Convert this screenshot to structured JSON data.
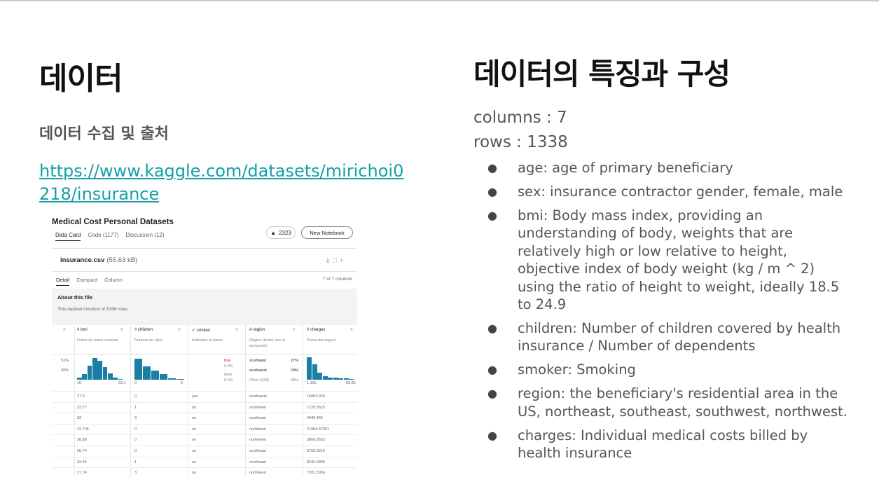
{
  "left": {
    "title": "데이터",
    "subtitle": "데이터 수집 및 출처",
    "source_url": "https://www.kaggle.com/datasets/mirichoi0218/insurance"
  },
  "kaggle": {
    "dataset_title": "Medical Cost Personal Datasets",
    "tabs": [
      "Data Card",
      "Code (1177)",
      "Discussion (12)"
    ],
    "vote_count": "2323",
    "new_notebook": "New Notebook",
    "file_name": "insurance.csv",
    "file_size": "(55.63 kB)",
    "view_tabs": [
      "Detail",
      "Compact",
      "Column"
    ],
    "column_count": "7 of 7 columns",
    "about_title": "About this file",
    "about_text": "This dataset consists of 1338 rows.",
    "columns": [
      {
        "name": "# bmi",
        "desc": "Índice de masa corporal"
      },
      {
        "name": "# children",
        "desc": "Número de hijos"
      },
      {
        "name": "✓ smoker",
        "desc": "Indicador al fumar"
      },
      {
        "name": "A region",
        "desc": "Región donde vive el asegurado"
      },
      {
        "name": "# charges",
        "desc": "Prima del seguro"
      }
    ],
    "left_pcts": [
      "51%",
      "49%"
    ],
    "bmi_range": [
      "16",
      "53.1"
    ],
    "children_range": [
      "0",
      "5"
    ],
    "smoker_values": [
      {
        "label": "true",
        "pct": "0.0%"
      },
      {
        "label": "false",
        "pct": "0.0%"
      }
    ],
    "region_values": [
      {
        "label": "southeast",
        "pct": "27%"
      },
      {
        "label": "southwest",
        "pct": "24%"
      },
      {
        "label": "Other (648)",
        "pct": "49%"
      }
    ],
    "charges_range": [
      "1.12k",
      "63.8k"
    ],
    "rows": [
      [
        "27.9",
        "0",
        "yes",
        "southwest",
        "16884.924"
      ],
      [
        "33.77",
        "1",
        "no",
        "southeast",
        "1725.5523"
      ],
      [
        "33",
        "3",
        "no",
        "southeast",
        "4449.462"
      ],
      [
        "22.705",
        "0",
        "no",
        "northwest",
        "21984.47061"
      ],
      [
        "28.88",
        "0",
        "no",
        "northwest",
        "3866.8552"
      ],
      [
        "25.74",
        "0",
        "no",
        "southeast",
        "3756.6216"
      ],
      [
        "33.44",
        "1",
        "no",
        "southeast",
        "8240.5896"
      ],
      [
        "27.74",
        "3",
        "no",
        "northwest",
        "7281.5056"
      ]
    ]
  },
  "right": {
    "title": "데이터의 특징과 구성",
    "columns_line": "columns : 7",
    "rows_line": "rows : 1338",
    "bullet_char": "●",
    "features": [
      "age: age of primary beneficiary",
      "sex: insurance contractor gender, female, male",
      "bmi: Body mass index, providing an understanding of body, weights that are relatively high or low relative to height, objective index of body weight (kg / m ^ 2) using the ratio of height to weight, ideally 18.5 to 24.9",
      "children: Number of children covered by health insurance / Number of dependents",
      "smoker: Smoking",
      "region: the beneficiary's residential area in the US, northeast, southeast, southwest, northwest.",
      "charges: Individual medical costs billed by health insurance"
    ]
  },
  "histograms": {
    "bmi": [
      0.08,
      0.25,
      0.62,
      0.98,
      0.85,
      0.55,
      0.28,
      0.1,
      0.04
    ],
    "children": [
      0.95,
      0.58,
      0.42,
      0.26,
      0.06,
      0.04
    ],
    "charges": [
      1.0,
      0.7,
      0.32,
      0.16,
      0.1,
      0.08,
      0.06,
      0.05,
      0.03
    ]
  }
}
